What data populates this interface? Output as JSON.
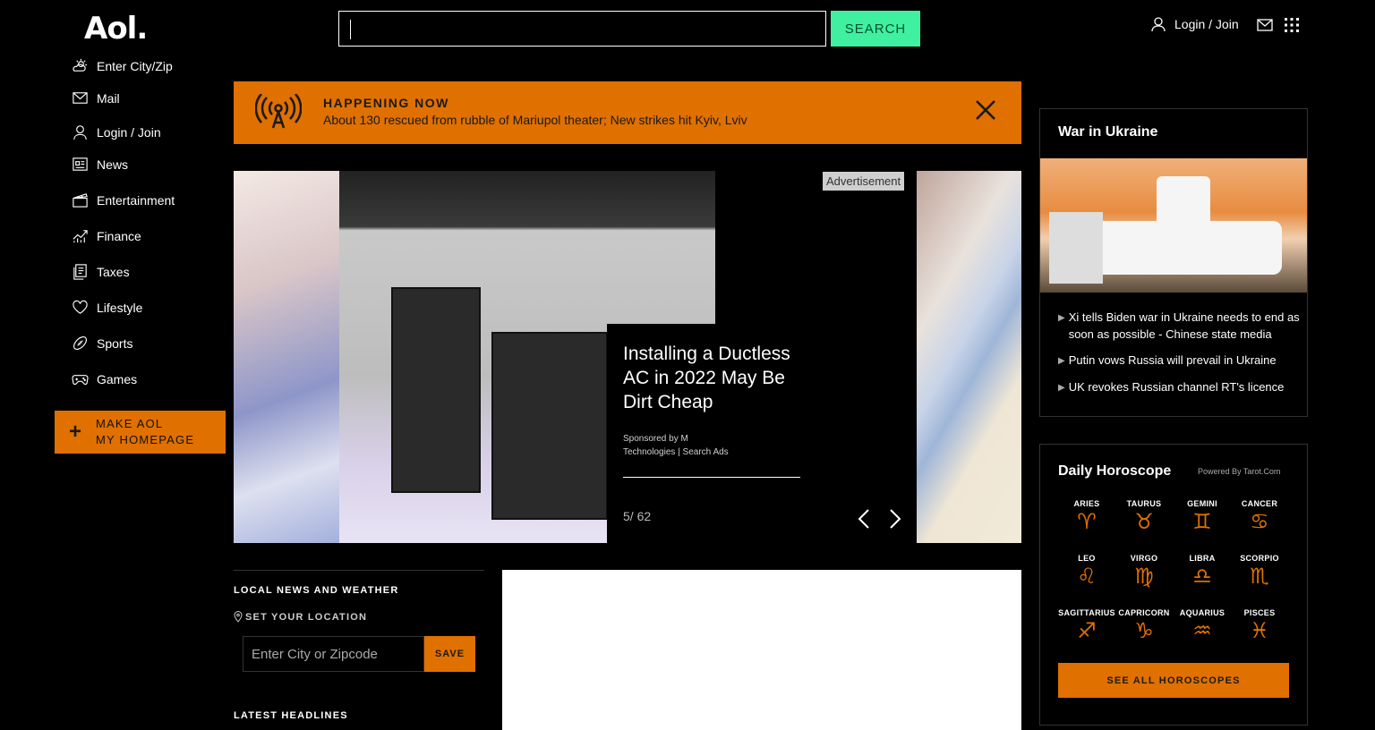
{
  "header": {
    "logo": "Aol.",
    "search_button": "SEARCH",
    "login_label": "Login / Join"
  },
  "sidebar": {
    "items": [
      {
        "label": "Enter City/Zip",
        "icon": "weather-icon"
      },
      {
        "label": "Mail",
        "icon": "mail-icon"
      },
      {
        "label": "Login / Join",
        "icon": "user-icon"
      },
      {
        "label": "News",
        "icon": "news-icon"
      },
      {
        "label": "Entertainment",
        "icon": "clapper-icon"
      },
      {
        "label": "Finance",
        "icon": "chart-icon"
      },
      {
        "label": "Taxes",
        "icon": "document-icon"
      },
      {
        "label": "Lifestyle",
        "icon": "heart-icon"
      },
      {
        "label": "Sports",
        "icon": "football-icon"
      },
      {
        "label": "Games",
        "icon": "gamepad-icon"
      }
    ],
    "make_home_line1": "MAKE AOL",
    "make_home_line2": "MY HOMEPAGE"
  },
  "banner": {
    "title": "HAPPENING NOW",
    "text": "About 130 rescued from rubble of Mariupol theater; New strikes hit Kyiv, Lviv"
  },
  "carousel": {
    "headline": "Installing a Ductless AC in 2022 May Be Dirt Cheap",
    "sponsor": "Sponsored by M Technologies | Search Ads",
    "counter": "5/ 62",
    "ad_label": "Advertisement"
  },
  "local": {
    "heading": "LOCAL NEWS AND WEATHER",
    "set_location": "SET YOUR LOCATION",
    "zip_placeholder": "Enter City or Zipcode",
    "save": "SAVE",
    "latest": "LATEST HEADLINES"
  },
  "war": {
    "heading": "War in Ukraine",
    "items": [
      "Xi tells Biden war in Ukraine needs to end as soon as possible - Chinese state media",
      "Putin vows Russia will prevail in Ukraine",
      "UK revokes Russian channel RT's licence"
    ]
  },
  "horoscope": {
    "heading": "Daily Horoscope",
    "powered": "Powered By Tarot.Com",
    "signs": [
      {
        "name": "ARIES",
        "symbol": "♈"
      },
      {
        "name": "TAURUS",
        "symbol": "♉"
      },
      {
        "name": "GEMINI",
        "symbol": "♊"
      },
      {
        "name": "CANCER",
        "symbol": "♋"
      },
      {
        "name": "LEO",
        "symbol": "♌"
      },
      {
        "name": "VIRGO",
        "symbol": "♍"
      },
      {
        "name": "LIBRA",
        "symbol": "♎"
      },
      {
        "name": "SCORPIO",
        "symbol": "♏"
      },
      {
        "name": "SAGITTARIUS",
        "symbol": "♐"
      },
      {
        "name": "CAPRICORN",
        "symbol": "♑"
      },
      {
        "name": "AQUARIUS",
        "symbol": "♒"
      },
      {
        "name": "PISCES",
        "symbol": "♓"
      }
    ],
    "button": "SEE ALL HOROSCOPES"
  },
  "colors": {
    "accent_orange": "#e07000",
    "search_green": "#3ff0a0",
    "background": "#000000"
  }
}
